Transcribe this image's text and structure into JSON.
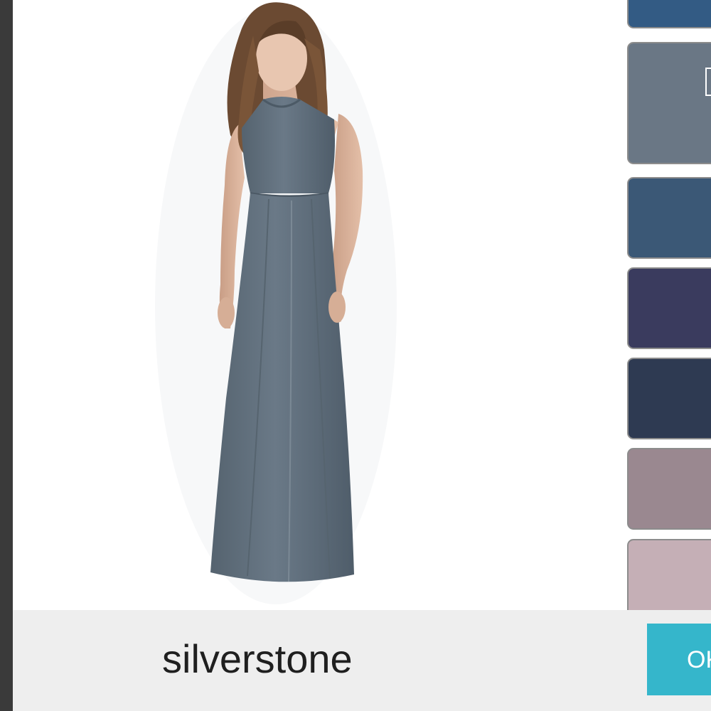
{
  "dialog": {
    "selected_color_name": "silverstone",
    "ok_label": "OK"
  },
  "dress_image": {
    "name": "dress-image",
    "color": "#5e6e7e"
  },
  "swatches": [
    {
      "name": "swatch-1",
      "color": "#335b84"
    },
    {
      "name": "swatch-2",
      "color": "#6a7785",
      "selected": true
    },
    {
      "name": "swatch-3",
      "color": "#3b5876"
    },
    {
      "name": "swatch-4",
      "color": "#3a3b5e"
    },
    {
      "name": "swatch-5",
      "color": "#2e3a52"
    },
    {
      "name": "swatch-6",
      "color": "#9a8890"
    },
    {
      "name": "swatch-7",
      "color": "#c5afb6"
    }
  ],
  "theme": {
    "accent": "#35b6cb",
    "bar_background": "#eeeeee"
  }
}
